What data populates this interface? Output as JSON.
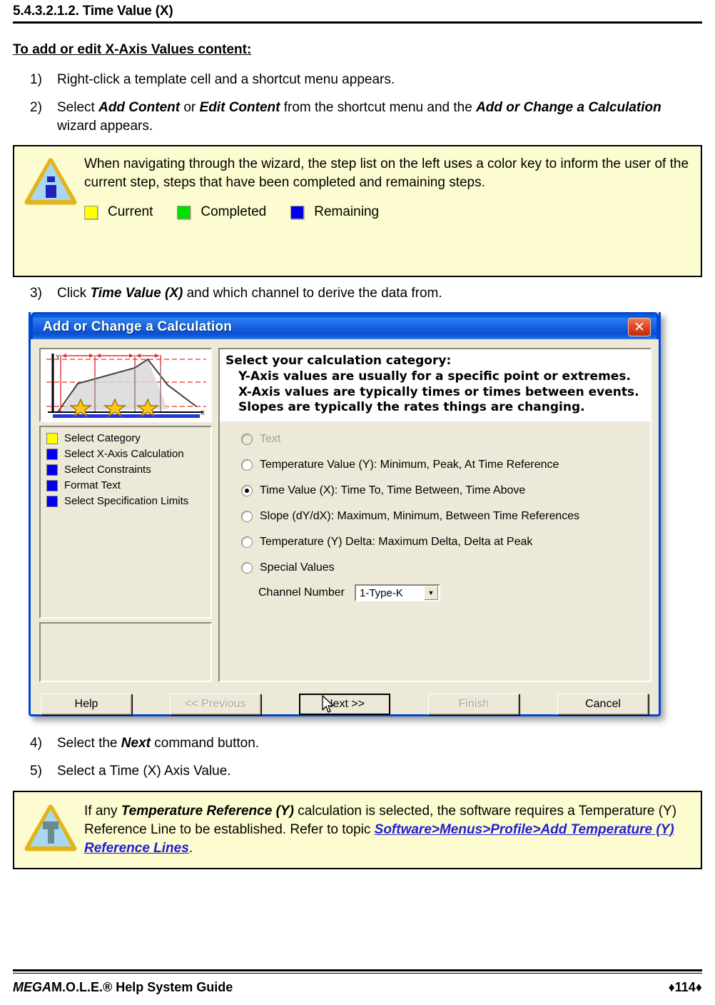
{
  "heading": "5.4.3.2.1.2. Time Value (X)",
  "section_lead": "To add or edit X-Axis Values content:",
  "steps": [
    {
      "num": "1)",
      "parts": [
        {
          "t": "Right-click a template cell and a shortcut menu appears.",
          "bold": false
        }
      ]
    },
    {
      "num": "2)",
      "parts": [
        {
          "t": "Select ",
          "bold": false
        },
        {
          "t": "Add Content",
          "bold": true
        },
        {
          "t": " or ",
          "bold": false
        },
        {
          "t": "Edit Content",
          "bold": true
        },
        {
          "t": " from the shortcut menu and the ",
          "bold": false
        },
        {
          "t": "Add or Change a Calculation",
          "bold": true
        },
        {
          "t": " wizard appears.",
          "bold": false
        }
      ]
    },
    {
      "num": "3)",
      "parts": [
        {
          "t": "Click ",
          "bold": false
        },
        {
          "t": "Time Value (X)",
          "bold": true
        },
        {
          "t": " and which channel to derive the data from.",
          "bold": false
        }
      ]
    },
    {
      "num": "4)",
      "parts": [
        {
          "t": "Select the ",
          "bold": false
        },
        {
          "t": "Next",
          "bold": true
        },
        {
          "t": " command button.",
          "bold": false
        }
      ]
    },
    {
      "num": "5)",
      "parts": [
        {
          "t": "Select a Time (X) Axis Value.",
          "bold": false
        }
      ]
    }
  ],
  "note_top": {
    "icon": "info-triangle-icon",
    "text": "When navigating through the wizard, the step list on the left uses a color key to inform the user of the current step, steps that have been completed and remaining steps.",
    "key": [
      {
        "label": "Current",
        "color": "#ffff00"
      },
      {
        "label": "Completed",
        "color": "#00e000"
      },
      {
        "label": "Remaining",
        "color": "#0000ee"
      }
    ]
  },
  "note_bottom": {
    "icon": "tip-triangle-icon",
    "parts": [
      {
        "t": "If any ",
        "style": "normal"
      },
      {
        "t": "Temperature Reference (Y)",
        "style": "bold"
      },
      {
        "t": " calculation is selected, the software requires a Temperature (Y) Reference Line to be established. Refer to topic ",
        "style": "normal"
      },
      {
        "t": "Software>Menus>Profile>Add Temperature (Y) Reference Lines",
        "style": "link"
      },
      {
        "t": ".",
        "style": "normal"
      }
    ]
  },
  "dialog": {
    "title": "Add or Change a Calculation",
    "close_label": "✕",
    "thumbnail": {
      "y_axis_label": "Y",
      "x_axis_label": "X"
    },
    "steplist": [
      {
        "label": "Select Category",
        "color": "#ffff00",
        "state": "current"
      },
      {
        "label": "Select X-Axis Calculation",
        "color": "#0000ee",
        "state": "remaining"
      },
      {
        "label": "Select Constraints",
        "color": "#0000ee",
        "state": "remaining"
      },
      {
        "label": "Format Text",
        "color": "#0000ee",
        "state": "remaining"
      },
      {
        "label": "Select Specification Limits",
        "color": "#0000ee",
        "state": "remaining"
      }
    ],
    "instructions": [
      "Select your calculation category:",
      "Y-Axis values are usually for a specific point or extremes.",
      "X-Axis values are typically times or times between events.",
      "Slopes are typically the rates things are changing."
    ],
    "radios": [
      {
        "label": "Text",
        "checked": false,
        "disabled": true
      },
      {
        "label": "Temperature Value (Y):  Minimum, Peak, At Time Reference",
        "checked": false,
        "disabled": false
      },
      {
        "label": "Time Value (X):  Time To, Time Between, Time Above",
        "checked": true,
        "disabled": false
      },
      {
        "label": "Slope (dY/dX):  Maximum, Minimum, Between Time References",
        "checked": false,
        "disabled": false
      },
      {
        "label": "Temperature (Y) Delta:  Maximum Delta, Delta at Peak",
        "checked": false,
        "disabled": false
      },
      {
        "label": "Special  Values",
        "checked": false,
        "disabled": false
      }
    ],
    "channel": {
      "label": "Channel Number",
      "value": "1-Type-K",
      "arrow": "▼"
    },
    "buttons": [
      {
        "label": "Help",
        "state": "enabled"
      },
      {
        "label": "<< Previous",
        "state": "disabled"
      },
      {
        "label": "Next >>",
        "state": "default"
      },
      {
        "label": "Finish",
        "state": "disabled"
      },
      {
        "label": "Cancel",
        "state": "enabled"
      }
    ]
  },
  "footer": {
    "mega": "MEGA",
    "guide": "M.O.L.E.® Help System Guide",
    "page": "♦114♦"
  }
}
